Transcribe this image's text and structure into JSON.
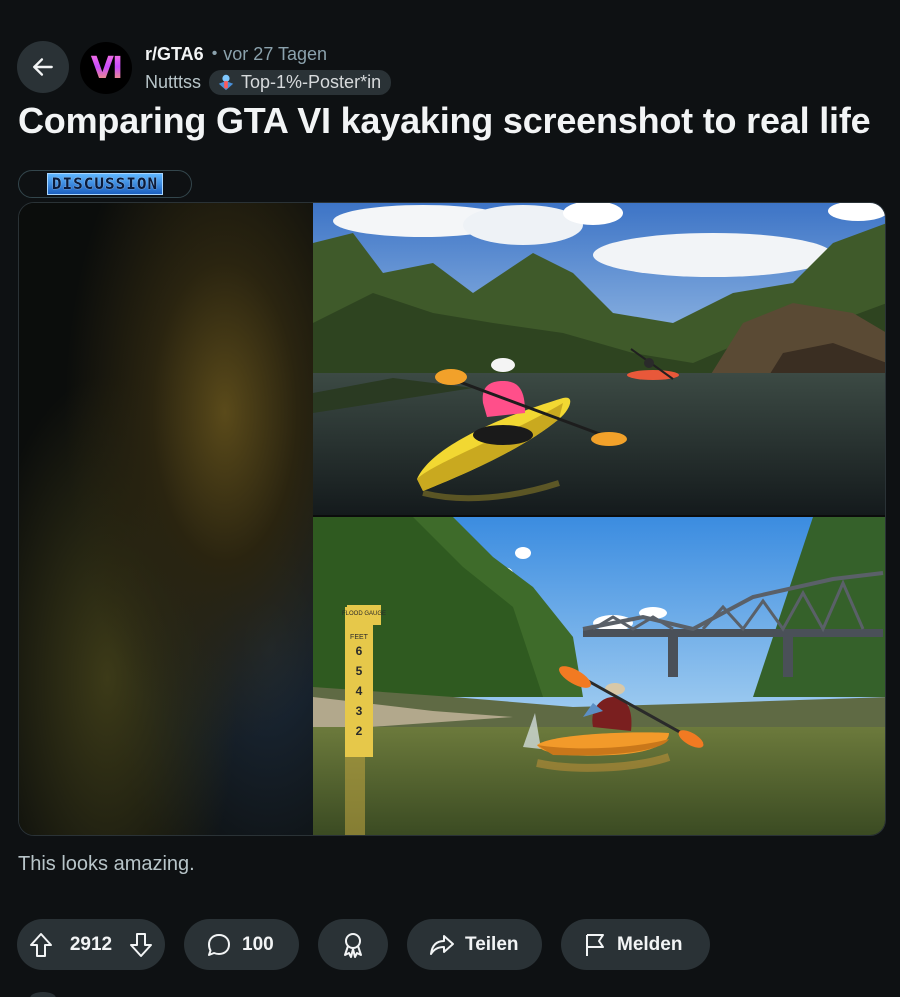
{
  "header": {
    "back_icon": "arrow-left-icon",
    "avatar_text": "VI",
    "subreddit": "r/GTA6",
    "separator": "•",
    "time": "vor 27 Tagen",
    "author": "Nutttss",
    "user_flair": "Top-1%-Poster*in",
    "user_flair_icon": "top-poster-icon"
  },
  "post": {
    "title": "Comparing GTA VI kayaking screenshot to real life",
    "flair": "DISCUSSION",
    "body": "This looks amazing.",
    "media": {
      "top_caption": "",
      "bottom_caption": "",
      "gauge_label": "FLOOD GAUGE",
      "gauge_unit": "FEET",
      "gauge_numbers": [
        "6",
        "5",
        "4",
        "3",
        "2"
      ]
    }
  },
  "actions": {
    "upvote_icon": "upvote-icon",
    "downvote_icon": "downvote-icon",
    "vote_count": "2912",
    "comment_icon": "comment-icon",
    "comment_count": "100",
    "award_icon": "award-icon",
    "share_icon": "share-icon",
    "share_label": "Teilen",
    "report_icon": "flag-icon",
    "report_label": "Melden"
  },
  "colors": {
    "background": "#0e1113",
    "pill": "#2a3236",
    "text": "#f2f4f5",
    "muted": "#8ba2ad"
  }
}
